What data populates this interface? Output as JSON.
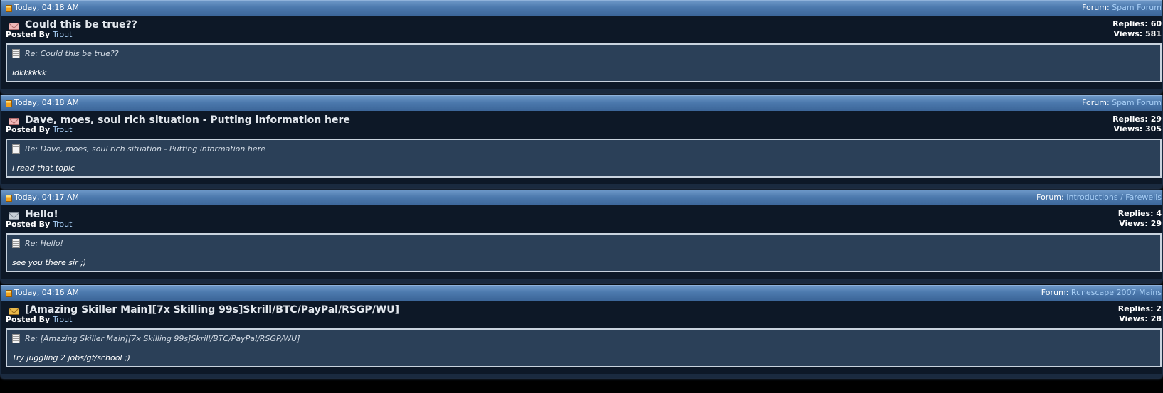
{
  "posts": [
    {
      "date": "Today, 04:18 AM",
      "forum_label": "Forum:",
      "forum_name": "Spam Forum",
      "title": "Could this be true??",
      "icon": "envelope-pink-icon",
      "posted_by_label": "Posted By",
      "author": "Trout",
      "replies_label": "Replies:",
      "replies": "60",
      "views_label": "Views:",
      "views": "581",
      "reply_title": "Re: Could this be true??",
      "reply_text": "idkkkkkk"
    },
    {
      "date": "Today, 04:18 AM",
      "forum_label": "Forum:",
      "forum_name": "Spam Forum",
      "title": "Dave, moes, soul rich situation - Putting information here",
      "icon": "envelope-pink-icon",
      "posted_by_label": "Posted By",
      "author": "Trout",
      "replies_label": "Replies:",
      "replies": "29",
      "views_label": "Views:",
      "views": "305",
      "reply_title": "Re: Dave, moes, soul rich situation - Putting information here",
      "reply_text": "i read that topic"
    },
    {
      "date": "Today, 04:17 AM",
      "forum_label": "Forum:",
      "forum_name": "Introductions / Farewells",
      "title": "Hello!",
      "icon": "envelope-grey-icon",
      "posted_by_label": "Posted By",
      "author": "Trout",
      "replies_label": "Replies:",
      "replies": "4",
      "views_label": "Views:",
      "views": "29",
      "reply_title": "Re: Hello!",
      "reply_text": "see you there sir ;)"
    },
    {
      "date": "Today, 04:16 AM",
      "forum_label": "Forum:",
      "forum_name": "Runescape 2007 Mains",
      "title": "[Amazing Skiller Main][7x Skilling 99s]Skrill/BTC/PayPal/RSGP/WU]",
      "icon": "envelope-gold-icon",
      "posted_by_label": "Posted By",
      "author": "Trout",
      "replies_label": "Replies:",
      "replies": "2",
      "views_label": "Views:",
      "views": "28",
      "reply_title": "Re: [Amazing Skiller Main][7x Skilling 99s]Skrill/BTC/PayPal/RSGP/WU]",
      "reply_text": "Try juggling 2 jobs/gf/school ;)"
    }
  ],
  "colors": {
    "header_blue": "#4c79ad",
    "link_blue": "#a8cff6",
    "body_dark": "#0d1827",
    "reply_box": "#2b4058",
    "reply_border": "#c9d3de"
  }
}
